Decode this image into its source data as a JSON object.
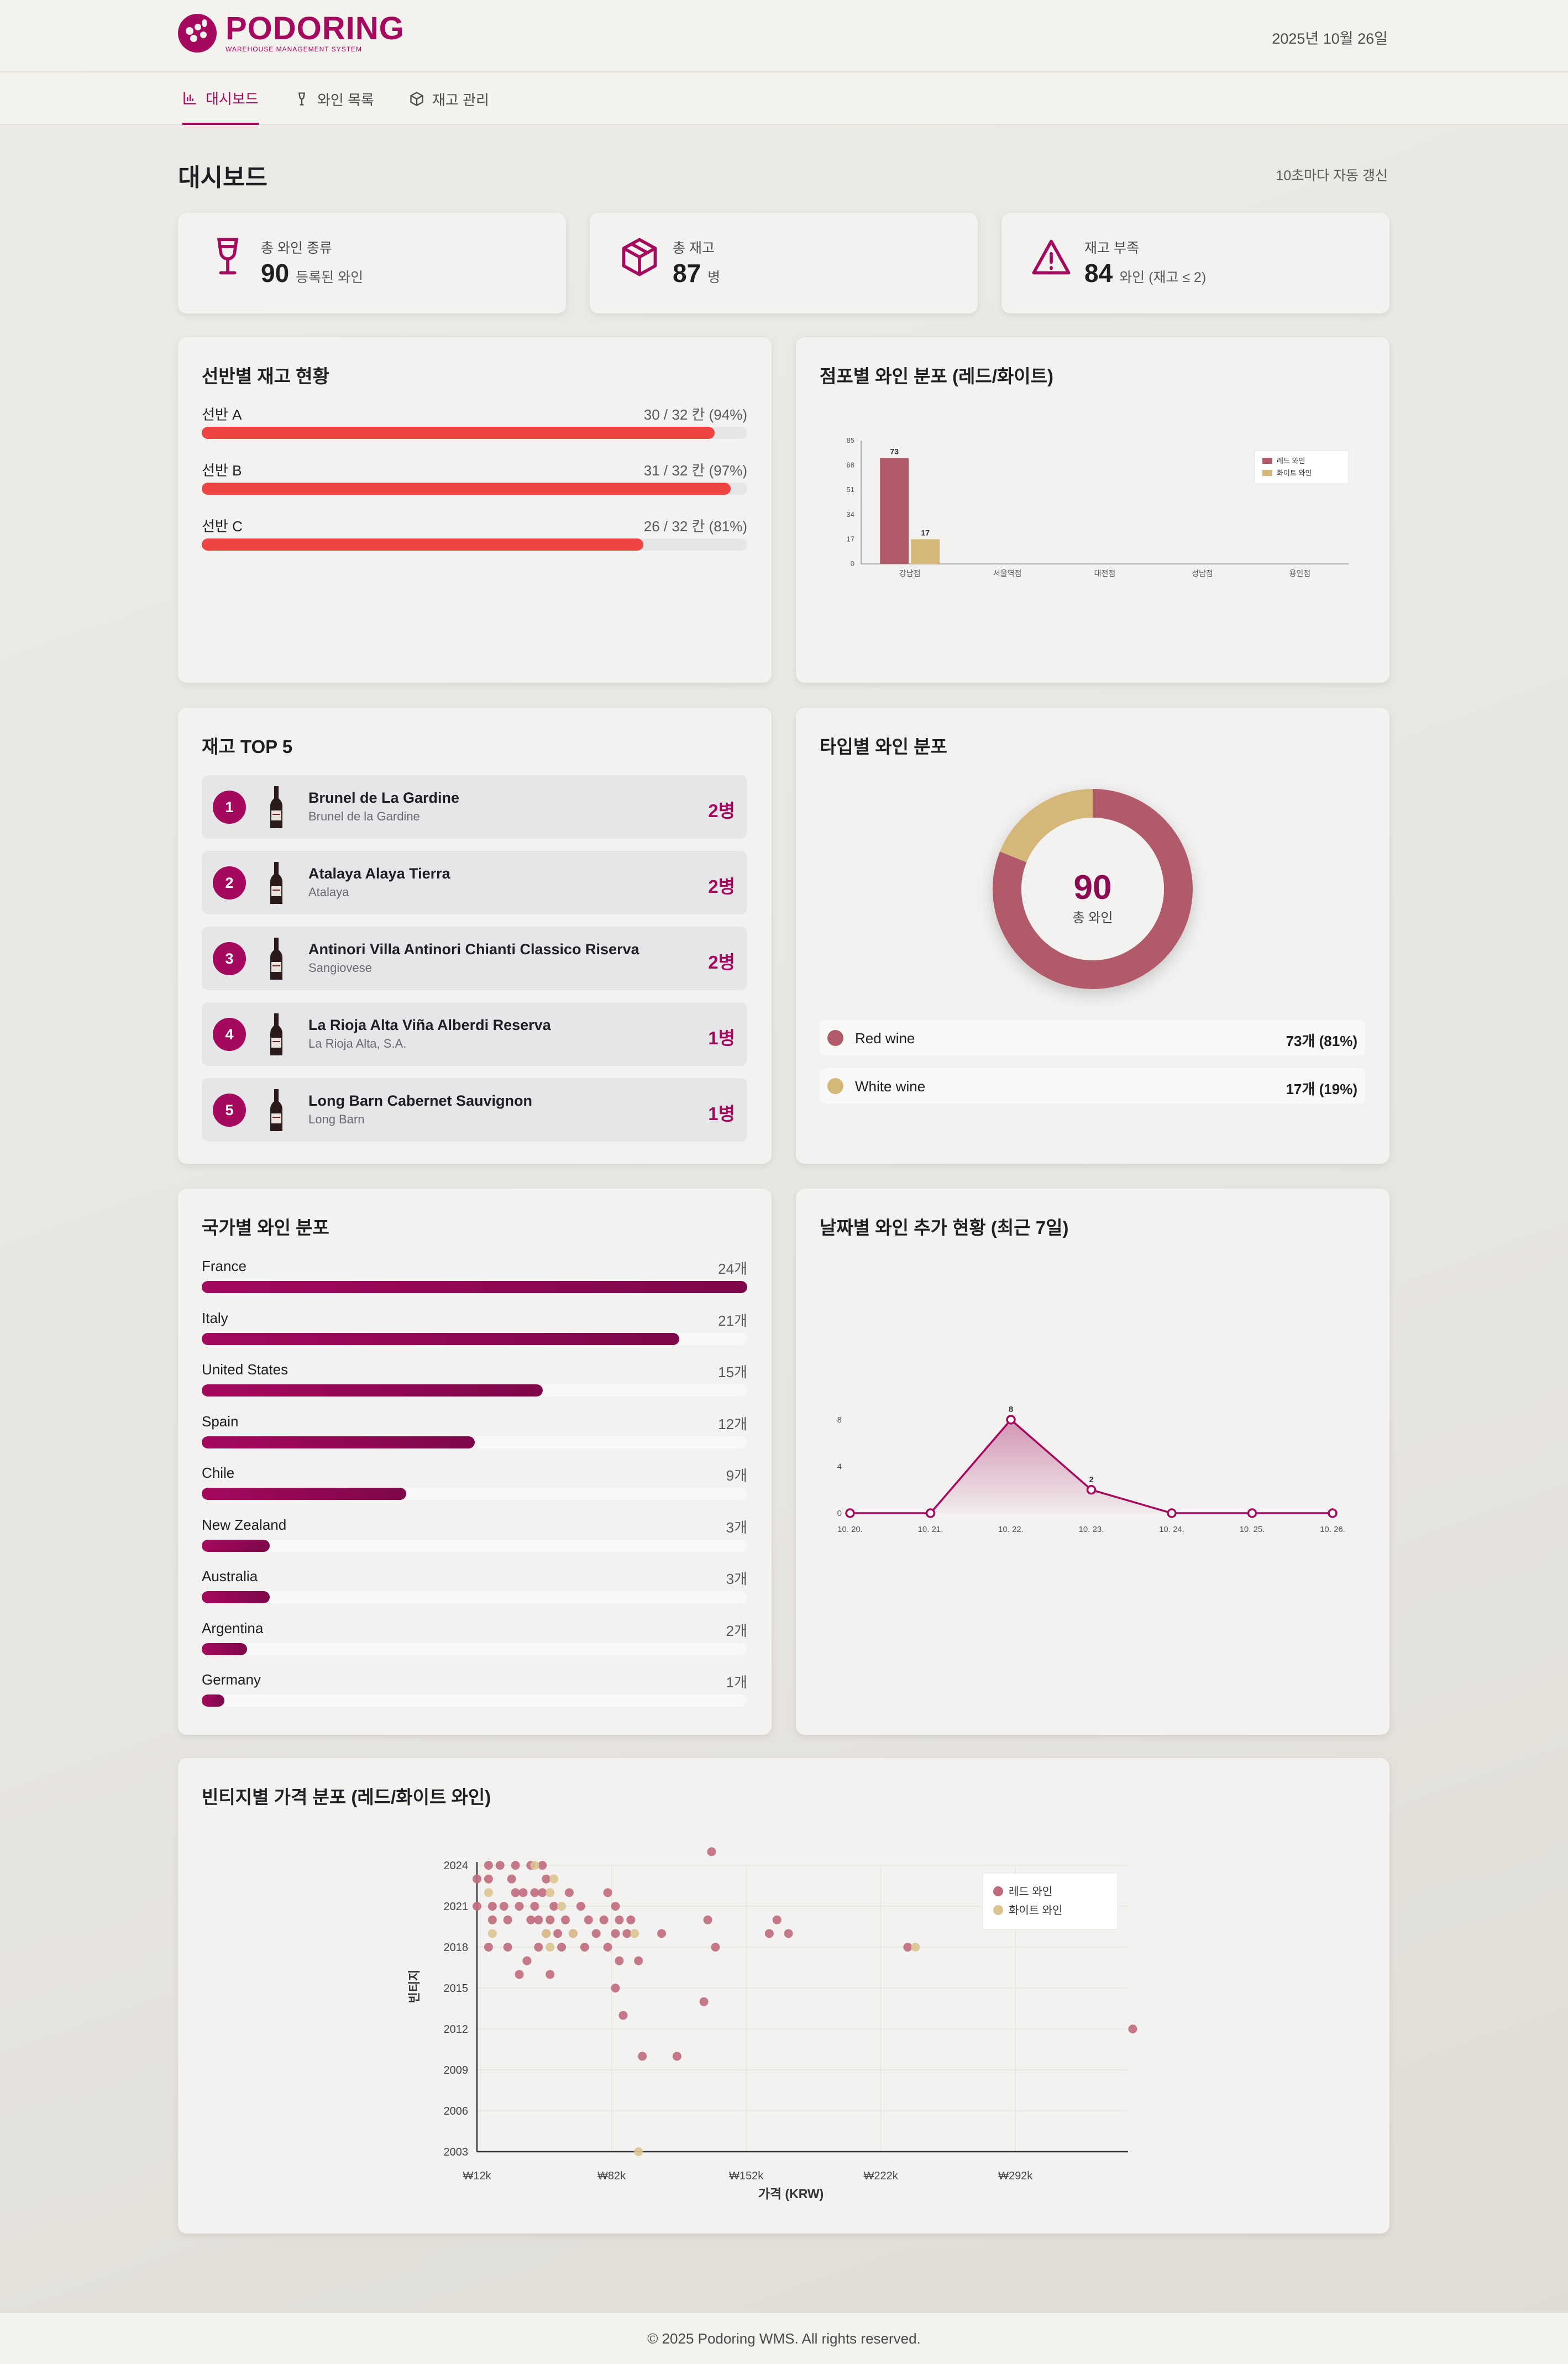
{
  "header": {
    "logo_title": "PODORING",
    "logo_subtitle": "WAREHOUSE MANAGEMENT SYSTEM",
    "date": "2025년 10월 26일"
  },
  "nav": {
    "items": [
      {
        "label": "대시보드",
        "icon": "chart-icon",
        "active": true
      },
      {
        "label": "와인 목록",
        "icon": "wine-glass-icon",
        "active": false
      },
      {
        "label": "재고 관리",
        "icon": "box-icon",
        "active": false
      }
    ]
  },
  "page": {
    "title": "대시보드",
    "refresh_note": "10초마다 자동 갱신"
  },
  "stats": [
    {
      "label": "총 와인 종류",
      "value": "90",
      "unit": "등록된 와인",
      "icon": "wine-glass-icon"
    },
    {
      "label": "총 재고",
      "value": "87",
      "unit": "병",
      "icon": "box-icon"
    },
    {
      "label": "재고 부족",
      "value": "84",
      "unit": "와인 (재고 ≤ 2)",
      "icon": "warning-icon"
    }
  ],
  "shelves": {
    "title": "선반별 재고 현황",
    "items": [
      {
        "name": "선반 A",
        "detail": "30 / 32 칸 (94%)",
        "percent": 94
      },
      {
        "name": "선반 B",
        "detail": "31 / 32 칸 (97%)",
        "percent": 97
      },
      {
        "name": "선반 C",
        "detail": "26 / 32 칸 (81%)",
        "percent": 81
      }
    ]
  },
  "store_chart": {
    "title": "점포별 와인 분포 (레드/화이트)",
    "chart_data": {
      "type": "bar",
      "categories": [
        "강남점",
        "서울역점",
        "대전점",
        "성남점",
        "용인점"
      ],
      "series": [
        {
          "name": "레드 와인",
          "values": [
            73,
            0,
            0,
            0,
            0
          ],
          "color": "#b05a6a"
        },
        {
          "name": "화이트 와인",
          "values": [
            17,
            0,
            0,
            0,
            0
          ],
          "color": "#d5b77a"
        }
      ],
      "ylim": [
        0,
        85
      ],
      "yticks": [
        "0",
        "17",
        "34",
        "51",
        "68",
        "85"
      ],
      "data_labels": [
        "73",
        "17"
      ],
      "legend": "top-right"
    }
  },
  "top5": {
    "title": "재고 TOP 5",
    "items": [
      {
        "rank": "1",
        "name": "Brunel de La Gardine",
        "sub": "Brunel de la Gardine",
        "qty": "2병"
      },
      {
        "rank": "2",
        "name": "Atalaya Alaya Tierra",
        "sub": "Atalaya",
        "qty": "2병"
      },
      {
        "rank": "3",
        "name": "Antinori Villa Antinori Chianti Classico Riserva",
        "sub": "Sangiovese",
        "qty": "2병"
      },
      {
        "rank": "4",
        "name": "La Rioja Alta Viña Alberdi Reserva",
        "sub": "La Rioja Alta, S.A.",
        "qty": "1병"
      },
      {
        "rank": "5",
        "name": "Long Barn Cabernet Sauvignon",
        "sub": "Long Barn",
        "qty": "1병"
      }
    ]
  },
  "type_chart": {
    "title": "타입별 와인 분포",
    "center_value": "90",
    "center_label": "총 와인",
    "chart_data": {
      "type": "pie",
      "categories": [
        "Red wine",
        "White wine"
      ],
      "values": [
        73,
        17
      ],
      "colors": [
        "#b05a6a",
        "#d5b77a"
      ],
      "legend_values": [
        "73개 (81%)",
        "17개 (19%)"
      ]
    }
  },
  "countries": {
    "title": "국가별 와인 분포",
    "max": 24,
    "items": [
      {
        "name": "France",
        "count_label": "24개",
        "count": 24
      },
      {
        "name": "Italy",
        "count_label": "21개",
        "count": 21
      },
      {
        "name": "United States",
        "count_label": "15개",
        "count": 15
      },
      {
        "name": "Spain",
        "count_label": "12개",
        "count": 12
      },
      {
        "name": "Chile",
        "count_label": "9개",
        "count": 9
      },
      {
        "name": "New Zealand",
        "count_label": "3개",
        "count": 3
      },
      {
        "name": "Australia",
        "count_label": "3개",
        "count": 3
      },
      {
        "name": "Argentina",
        "count_label": "2개",
        "count": 2
      },
      {
        "name": "Germany",
        "count_label": "1개",
        "count": 1
      }
    ]
  },
  "daily_chart": {
    "title": "날짜별 와인 추가 현황 (최근 7일)",
    "chart_data": {
      "type": "area",
      "categories": [
        "10. 20.",
        "10. 21.",
        "10. 22.",
        "10. 23.",
        "10. 24.",
        "10. 25.",
        "10. 26."
      ],
      "values": [
        0,
        0,
        8,
        2,
        0,
        0,
        0
      ],
      "yticks": [
        "0",
        "4",
        "8"
      ],
      "ylim": [
        0,
        8
      ],
      "data_labels": [
        "8",
        "2"
      ],
      "color": "#a4095e"
    }
  },
  "vintage_chart": {
    "title": "빈티지별 가격 분포 (레드/화이트 와인)",
    "chart_data": {
      "type": "scatter",
      "xlabel": "가격 (KRW)",
      "ylabel": "빈티지",
      "xlim": [
        12000,
        350000
      ],
      "ylim": [
        2003,
        2024
      ],
      "xticks": [
        "₩12k",
        "₩82k",
        "₩152k",
        "₩222k",
        "₩292k"
      ],
      "xtick_values": [
        12000,
        82000,
        152000,
        222000,
        292000
      ],
      "yticks": [
        "2003",
        "2006",
        "2009",
        "2012",
        "2015",
        "2018",
        "2021",
        "2024"
      ],
      "ytick_values": [
        2003,
        2006,
        2009,
        2012,
        2015,
        2018,
        2021,
        2024
      ],
      "legend": "top-right",
      "series": [
        {
          "name": "레드 와인",
          "color": "#c06a7b",
          "points": [
            [
              18000,
              2024
            ],
            [
              24000,
              2024
            ],
            [
              12000,
              2023
            ],
            [
              18000,
              2023
            ],
            [
              30000,
              2023
            ],
            [
              32000,
              2024
            ],
            [
              40000,
              2024
            ],
            [
              46000,
              2024
            ],
            [
              48000,
              2023
            ],
            [
              32000,
              2022
            ],
            [
              36000,
              2022
            ],
            [
              42000,
              2022
            ],
            [
              46000,
              2022
            ],
            [
              60000,
              2022
            ],
            [
              80000,
              2022
            ],
            [
              12000,
              2021
            ],
            [
              20000,
              2021
            ],
            [
              26000,
              2021
            ],
            [
              34000,
              2021
            ],
            [
              42000,
              2021
            ],
            [
              52000,
              2021
            ],
            [
              66000,
              2021
            ],
            [
              84000,
              2021
            ],
            [
              20000,
              2020
            ],
            [
              28000,
              2020
            ],
            [
              40000,
              2020
            ],
            [
              44000,
              2020
            ],
            [
              50000,
              2020
            ],
            [
              58000,
              2020
            ],
            [
              70000,
              2020
            ],
            [
              78000,
              2020
            ],
            [
              86000,
              2020
            ],
            [
              92000,
              2020
            ],
            [
              132000,
              2020
            ],
            [
              168000,
              2020
            ],
            [
              48000,
              2019
            ],
            [
              54000,
              2019
            ],
            [
              62000,
              2019
            ],
            [
              74000,
              2019
            ],
            [
              84000,
              2019
            ],
            [
              90000,
              2019
            ],
            [
              108000,
              2019
            ],
            [
              164000,
              2019
            ],
            [
              174000,
              2019
            ],
            [
              18000,
              2018
            ],
            [
              28000,
              2018
            ],
            [
              44000,
              2018
            ],
            [
              56000,
              2018
            ],
            [
              68000,
              2018
            ],
            [
              80000,
              2018
            ],
            [
              136000,
              2018
            ],
            [
              236000,
              2018
            ],
            [
              38000,
              2017
            ],
            [
              86000,
              2017
            ],
            [
              96000,
              2017
            ],
            [
              34000,
              2016
            ],
            [
              50000,
              2016
            ],
            [
              84000,
              2015
            ],
            [
              130000,
              2014
            ],
            [
              88000,
              2013
            ],
            [
              98000,
              2010
            ],
            [
              116000,
              2010
            ],
            [
              134000,
              2025
            ],
            [
              353000,
              2012
            ]
          ]
        },
        {
          "name": "화이트 와인",
          "color": "#dcc490",
          "points": [
            [
              18000,
              2022
            ],
            [
              42000,
              2024
            ],
            [
              52000,
              2023
            ],
            [
              50000,
              2022
            ],
            [
              56000,
              2021
            ],
            [
              20000,
              2019
            ],
            [
              48000,
              2019
            ],
            [
              62000,
              2019
            ],
            [
              94000,
              2019
            ],
            [
              50000,
              2018
            ],
            [
              96000,
              2003
            ],
            [
              240000,
              2018
            ]
          ]
        }
      ]
    }
  },
  "footer": {
    "text": "© 2025 Podoring WMS. All rights reserved."
  }
}
